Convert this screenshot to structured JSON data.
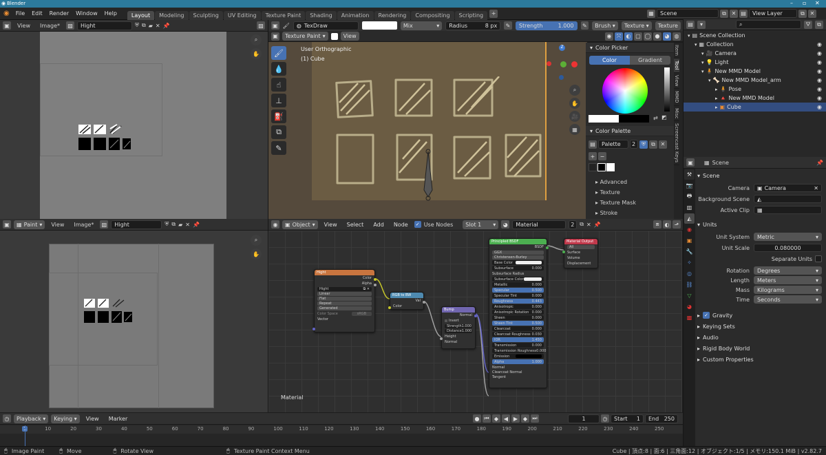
{
  "window": {
    "title": "Blender"
  },
  "menu": [
    "File",
    "Edit",
    "Render",
    "Window",
    "Help"
  ],
  "workspaces": [
    "Layout",
    "Modeling",
    "Sculpting",
    "UV Editing",
    "Texture Paint",
    "Shading",
    "Animation",
    "Rendering",
    "Compositing",
    "Scripting"
  ],
  "active_workspace": "Layout",
  "scene_field": "Scene",
  "view_layer_field": "View Layer",
  "image_editor_top": {
    "view": "View",
    "image": "Image*",
    "image_name": "Hight"
  },
  "image_editor_bottom": {
    "mode": "Paint",
    "view": "View",
    "image": "Image*",
    "image_name": "Hight"
  },
  "tool_header": {
    "brush": "TexDraw",
    "blend": "Mix",
    "radius_label": "Radius",
    "radius_value": "8 px",
    "strength_label": "Strength",
    "strength_value": "1.000",
    "brush_btn": "Brush",
    "texture_btn": "Texture",
    "texture2_btn": "Texture"
  },
  "viewport": {
    "mode": "Texture Paint",
    "view": "View",
    "overlay_line1": "User Orthographic",
    "overlay_line2": "(1) Cube"
  },
  "npanel": {
    "color_picker": "Color Picker",
    "color_tab": "Color",
    "gradient_tab": "Gradient",
    "color_palette": "Color Palette",
    "palette_name": "Palette",
    "palette_users": "2",
    "plus": "+",
    "minus": "−",
    "advanced": "Advanced",
    "texture": "Texture",
    "texture_mask": "Texture Mask",
    "stroke": "Stroke"
  },
  "ntabs": [
    "Item",
    "Tool",
    "View",
    "MMD",
    "Misc",
    "Screencast Keys"
  ],
  "outliner": {
    "items": [
      {
        "label": "Scene Collection",
        "indent": 0
      },
      {
        "label": "Collection",
        "indent": 1
      },
      {
        "label": "Camera",
        "indent": 2
      },
      {
        "label": "Light",
        "indent": 2
      },
      {
        "label": "New MMD Model",
        "indent": 2
      },
      {
        "label": "New MMD Model_arm",
        "indent": 3
      },
      {
        "label": "Pose",
        "indent": 4
      },
      {
        "label": "New MMD Model",
        "indent": 4
      },
      {
        "label": "Cube",
        "indent": 4
      }
    ]
  },
  "properties": {
    "header": "Scene",
    "scene_section": "Scene",
    "camera_label": "Camera",
    "camera_value": "Camera",
    "background_label": "Background Scene",
    "clip_label": "Active Clip",
    "units_section": "Units",
    "unit_system_label": "Unit System",
    "unit_system_value": "Metric",
    "unit_scale_label": "Unit Scale",
    "unit_scale_value": "0.080000",
    "separate_units": "Separate Units",
    "rotation_label": "Rotation",
    "rotation_value": "Degrees",
    "length_label": "Length",
    "length_value": "Meters",
    "mass_label": "Mass",
    "mass_value": "Kilograms",
    "time_label": "Time",
    "time_value": "Seconds",
    "gravity": "Gravity",
    "keying_sets": "Keying Sets",
    "audio": "Audio",
    "rigid_body": "Rigid Body World",
    "custom_props": "Custom Properties"
  },
  "node_editor": {
    "object_mode": "Object",
    "view": "View",
    "select": "Select",
    "add": "Add",
    "node": "Node",
    "use_nodes": "Use Nodes",
    "slot": "Slot 1",
    "material": "Material",
    "material_users": "2",
    "label": "Material",
    "image_node": {
      "title": "Hight",
      "out_color": "Color",
      "out_alpha": "Alpha",
      "image": "Hight",
      "interp": "Linear",
      "proj": "Flat",
      "ext": "Repeat",
      "src": "Generated",
      "cs_label": "Color Space",
      "cs_value": "sRGB",
      "in_vector": "Vector"
    },
    "rgbbw_node": {
      "title": "RGB to BW",
      "out": "Val",
      "in": "Color"
    },
    "bump_node": {
      "title": "Bump",
      "out": "Normal",
      "invert": "Invert",
      "strength": "Strength",
      "strength_v": "1.000",
      "distance": "Distance",
      "distance_v": "1.000",
      "height": "Height",
      "normal": "Normal"
    },
    "bsdf_node": {
      "title": "Principled BSDF",
      "out": "BSDF",
      "dist": "GGX",
      "sss": "Christensen-Burley",
      "rows": [
        [
          "Base Color",
          ""
        ],
        [
          "Subsurface",
          "0.000"
        ],
        [
          "Subsurface Radius",
          ""
        ],
        [
          "Subsurface Color",
          ""
        ],
        [
          "Metallic",
          "0.000"
        ],
        [
          "Specular",
          "0.500"
        ],
        [
          "Specular Tint",
          "0.000"
        ],
        [
          "Roughness",
          "0.443"
        ],
        [
          "Anisotropic",
          "0.000"
        ],
        [
          "Anisotropic Rotation",
          "0.000"
        ],
        [
          "Sheen",
          "0.000"
        ],
        [
          "Sheen Tint",
          "0.500"
        ],
        [
          "Clearcoat",
          "0.000"
        ],
        [
          "Clearcoat Roughness",
          "0.030"
        ],
        [
          "IOR",
          "1.450"
        ],
        [
          "Transmission",
          "0.000"
        ],
        [
          "Transmission Roughness",
          "0.000"
        ],
        [
          "Emission",
          ""
        ],
        [
          "Alpha",
          "1.000"
        ],
        [
          "Normal",
          ""
        ],
        [
          "Clearcoat Normal",
          ""
        ],
        [
          "Tangent",
          ""
        ]
      ]
    },
    "output_node": {
      "title": "Material Output",
      "target": "All",
      "surface": "Surface",
      "volume": "Volume",
      "displacement": "Displacement"
    }
  },
  "timeline": {
    "playback": "Playback",
    "keying": "Keying",
    "view": "View",
    "marker": "Marker",
    "current": "1",
    "start_label": "Start",
    "start": "1",
    "end_label": "End",
    "end": "250",
    "ticks": [
      "1",
      "10",
      "20",
      "30",
      "40",
      "50",
      "60",
      "70",
      "80",
      "90",
      "100",
      "110",
      "120",
      "130",
      "140",
      "150",
      "160",
      "170",
      "180",
      "190",
      "200",
      "210",
      "220",
      "230",
      "240",
      "250"
    ]
  },
  "status": {
    "left1": "Image Paint",
    "left2": "Move",
    "left3": "Rotate View",
    "left4": "Texture Paint Context Menu",
    "right": "Cube | 頂点:8 | 面:6 | 三角面:12 | オブジェクト:1/5 | メモリ:150.1 MiB | v2.82.7"
  },
  "colors": {
    "accent": "#4772b3",
    "title_bar": "#2c7a9c",
    "image_node": "#c9753f",
    "rgb_node": "#4e8ab0",
    "bump_node": "#7166b0",
    "bsdf_node": "#4caf50",
    "output_node": "#c0394b"
  }
}
